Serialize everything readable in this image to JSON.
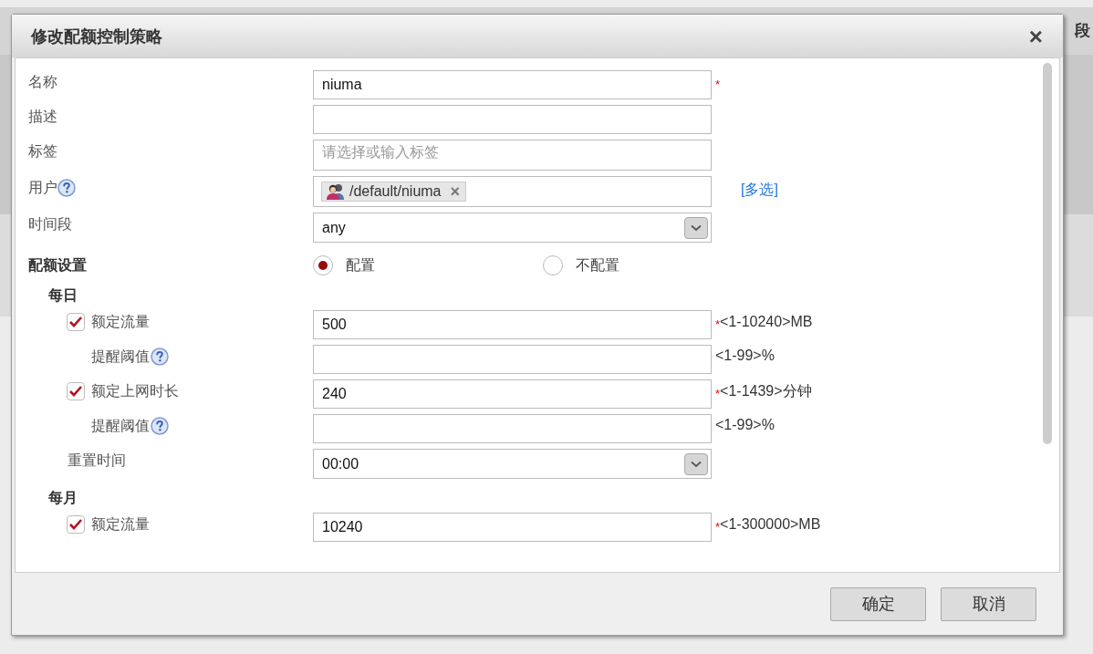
{
  "background": {
    "header_fragment": "段"
  },
  "dialog": {
    "title": "修改配额控制策略",
    "close": "×"
  },
  "fields": [
    {
      "kind": "text",
      "label": "名称",
      "value": "niuma",
      "required_mark": "*"
    },
    {
      "kind": "text",
      "label": "描述"
    },
    {
      "kind": "text",
      "label": "标签",
      "placeholder": "请选择或输入标签"
    },
    {
      "kind": "tags",
      "label": "用户",
      "help": true,
      "tags": [
        {
          "text": "/default/niuma",
          "remove": "×"
        }
      ],
      "link": "[多选]"
    },
    {
      "kind": "select",
      "label": "时间段",
      "value": "any"
    }
  ],
  "quota": {
    "label": "配额设置",
    "options": [
      {
        "label": "配置",
        "selected": true
      },
      {
        "label": "不配置",
        "selected": false
      }
    ]
  },
  "sections": [
    {
      "title": "每日",
      "rows": [
        {
          "kind": "check",
          "label": "额定流量",
          "checked": true,
          "value": "500",
          "required_mark": "*",
          "hint": "<1-10240>MB"
        },
        {
          "kind": "threshold",
          "label": "提醒阈值",
          "help": true,
          "hint": "<1-99>%"
        },
        {
          "kind": "check",
          "label": "额定上网时长",
          "checked": true,
          "value": "240",
          "required_mark": "*",
          "hint": "<1-1439>分钟"
        },
        {
          "kind": "threshold",
          "label": "提醒阈值",
          "help": true,
          "hint": "<1-99>%"
        },
        {
          "kind": "select",
          "label": "重置时间",
          "value": "00:00"
        }
      ]
    },
    {
      "title": "每月",
      "rows": [
        {
          "kind": "check",
          "label": "额定流量",
          "checked": true,
          "value": "10240",
          "required_mark": "*",
          "hint": "<1-300000>MB"
        }
      ]
    }
  ],
  "buttons": [
    "确定",
    "取消"
  ]
}
